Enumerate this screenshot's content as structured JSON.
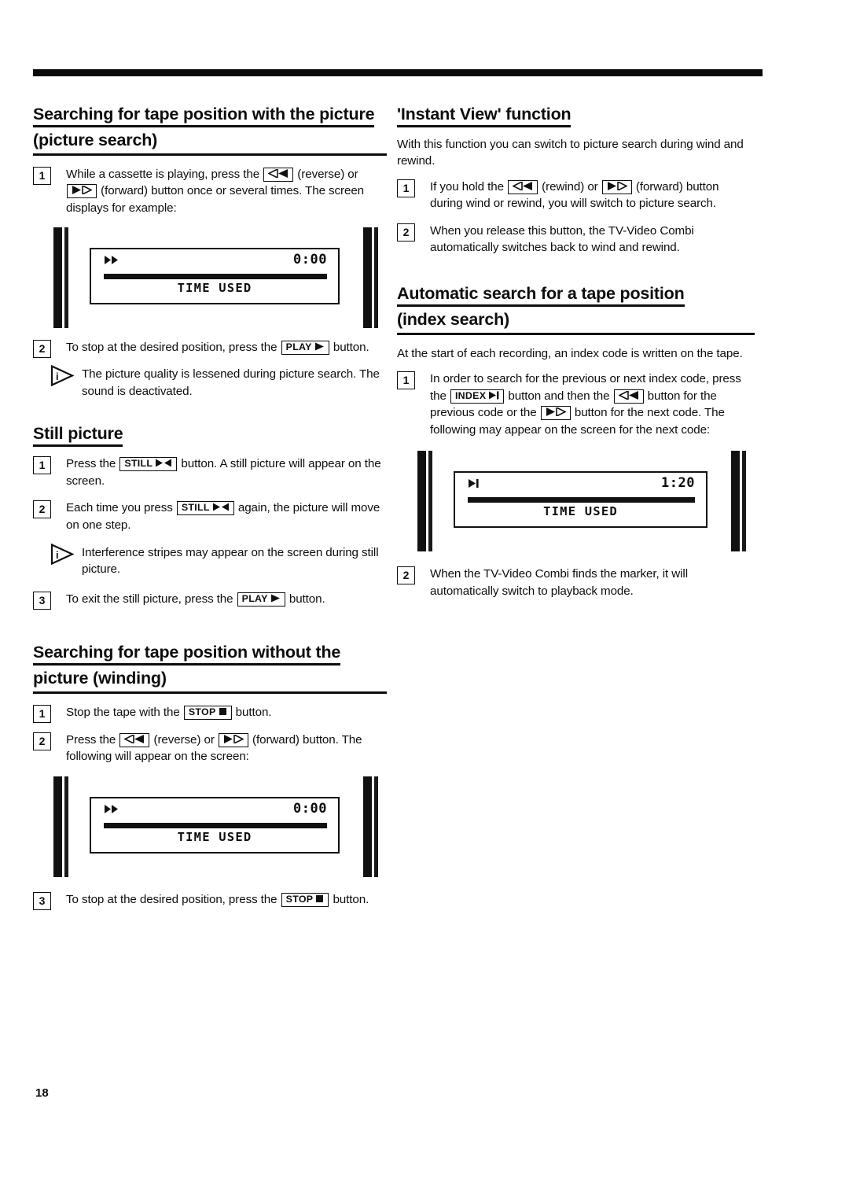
{
  "page": {
    "number": "18",
    "rule": "top-divider"
  },
  "left_column": {
    "section1": {
      "heading_line1": "Searching for tape position with the picture",
      "heading_line2": "(picture search)",
      "steps": [
        {
          "num": "1",
          "parts": [
            {
              "t": "text",
              "v": "While a cassette is playing, press the "
            },
            {
              "t": "key",
              "icon": "rewind-double-left",
              "label": ""
            },
            {
              "t": "text",
              "v": " (reverse) or "
            },
            {
              "t": "key",
              "icon": "forward-double-right",
              "label": ""
            },
            {
              "t": "text",
              "v": " (forward) button once or several times. The screen displays for example:"
            }
          ]
        }
      ],
      "screen": {
        "icon": "fast-forward-icon",
        "time": "0:00",
        "label": "TIME USED"
      },
      "step2": {
        "num": "2",
        "parts": [
          {
            "t": "text",
            "v": "To stop at the desired position, press the "
          },
          {
            "t": "key",
            "icon": "play-right",
            "label": "PLAY"
          },
          {
            "t": "text",
            "v": " button."
          }
        ]
      },
      "note": "The picture quality is lessened during picture search. The sound is deactivated."
    },
    "section2": {
      "heading_line1": "Still picture",
      "step1": {
        "num": "1",
        "parts": [
          {
            "t": "text",
            "v": "Press the "
          },
          {
            "t": "key",
            "icon": "still-step",
            "label": "STILL"
          },
          {
            "t": "text",
            "v": " button. A still picture will appear on the screen."
          }
        ]
      },
      "step2": {
        "num": "2",
        "parts": [
          {
            "t": "text",
            "v": "Each time you press "
          },
          {
            "t": "key",
            "icon": "still-step",
            "label": "STILL"
          },
          {
            "t": "text",
            "v": " again, the picture will move on one step."
          }
        ]
      },
      "note": "Interference stripes may appear on the screen during still picture.",
      "step3": {
        "num": "3",
        "parts": [
          {
            "t": "text",
            "v": "To exit the still picture, press the "
          },
          {
            "t": "key",
            "icon": "play-right",
            "label": "PLAY"
          },
          {
            "t": "text",
            "v": " button."
          }
        ]
      }
    },
    "section3": {
      "heading_line1": "Searching for tape position without the",
      "heading_line2": "picture (winding)",
      "step1": {
        "num": "1",
        "parts": [
          {
            "t": "text",
            "v": "Stop the tape with the "
          },
          {
            "t": "key",
            "icon": "stop-square",
            "label": "STOP"
          },
          {
            "t": "text",
            "v": " button."
          }
        ]
      },
      "step2": {
        "num": "2",
        "parts": [
          {
            "t": "text",
            "v": "Press the "
          },
          {
            "t": "key",
            "icon": "rewind-double-left",
            "label": ""
          },
          {
            "t": "text",
            "v": " (reverse) or "
          },
          {
            "t": "key",
            "icon": "forward-double-right",
            "label": ""
          },
          {
            "t": "text",
            "v": " (forward) button. The following will appear on the screen:"
          }
        ]
      },
      "screen": {
        "icon": "fast-forward-icon",
        "time": "0:00",
        "label": "TIME USED"
      },
      "step3": {
        "num": "3",
        "parts": [
          {
            "t": "text",
            "v": "To stop at the desired position, press the "
          },
          {
            "t": "key",
            "icon": "stop-square",
            "label": "STOP"
          },
          {
            "t": "text",
            "v": " button."
          }
        ]
      }
    }
  },
  "right_column": {
    "section1": {
      "heading_line1": "'Instant View' function",
      "intro": "With this function you can switch to picture search during wind and rewind.",
      "step1": {
        "num": "1",
        "parts": [
          {
            "t": "text",
            "v": "If you hold the "
          },
          {
            "t": "key",
            "icon": "rewind-double-left",
            "label": ""
          },
          {
            "t": "text",
            "v": " (rewind) or "
          },
          {
            "t": "key",
            "icon": "forward-double-right",
            "label": ""
          },
          {
            "t": "text",
            "v": " (forward) button during wind or rewind, you will switch to picture search."
          }
        ]
      },
      "step2": {
        "num": "2",
        "text": "When you release this button, the TV-Video Combi automatically switches back to wind and rewind."
      }
    },
    "section2": {
      "heading_line1": "Automatic search for a tape position",
      "heading_line2": "(index search)",
      "intro": "At the start of each recording, an index code is written on the tape.",
      "step1": {
        "num": "1",
        "parts": [
          {
            "t": "text",
            "v": "In order to search for the previous or next index code, press the "
          },
          {
            "t": "key",
            "icon": "index-marker",
            "label": "INDEX"
          },
          {
            "t": "text",
            "v": " button and then the "
          },
          {
            "t": "key",
            "icon": "rewind-double-left",
            "label": ""
          },
          {
            "t": "text",
            "v": " button for the previous code or the "
          },
          {
            "t": "key",
            "icon": "forward-double-right",
            "label": ""
          },
          {
            "t": "text",
            "v": " button for the next code. The following may appear on the screen for the next code:"
          }
        ]
      },
      "screen": {
        "icon": "play-to-marker-icon",
        "time": "1:20",
        "label": "TIME USED"
      },
      "step2": {
        "num": "2",
        "text": "When the TV-Video Combi finds the marker, it will automatically switch to playback mode."
      }
    }
  }
}
